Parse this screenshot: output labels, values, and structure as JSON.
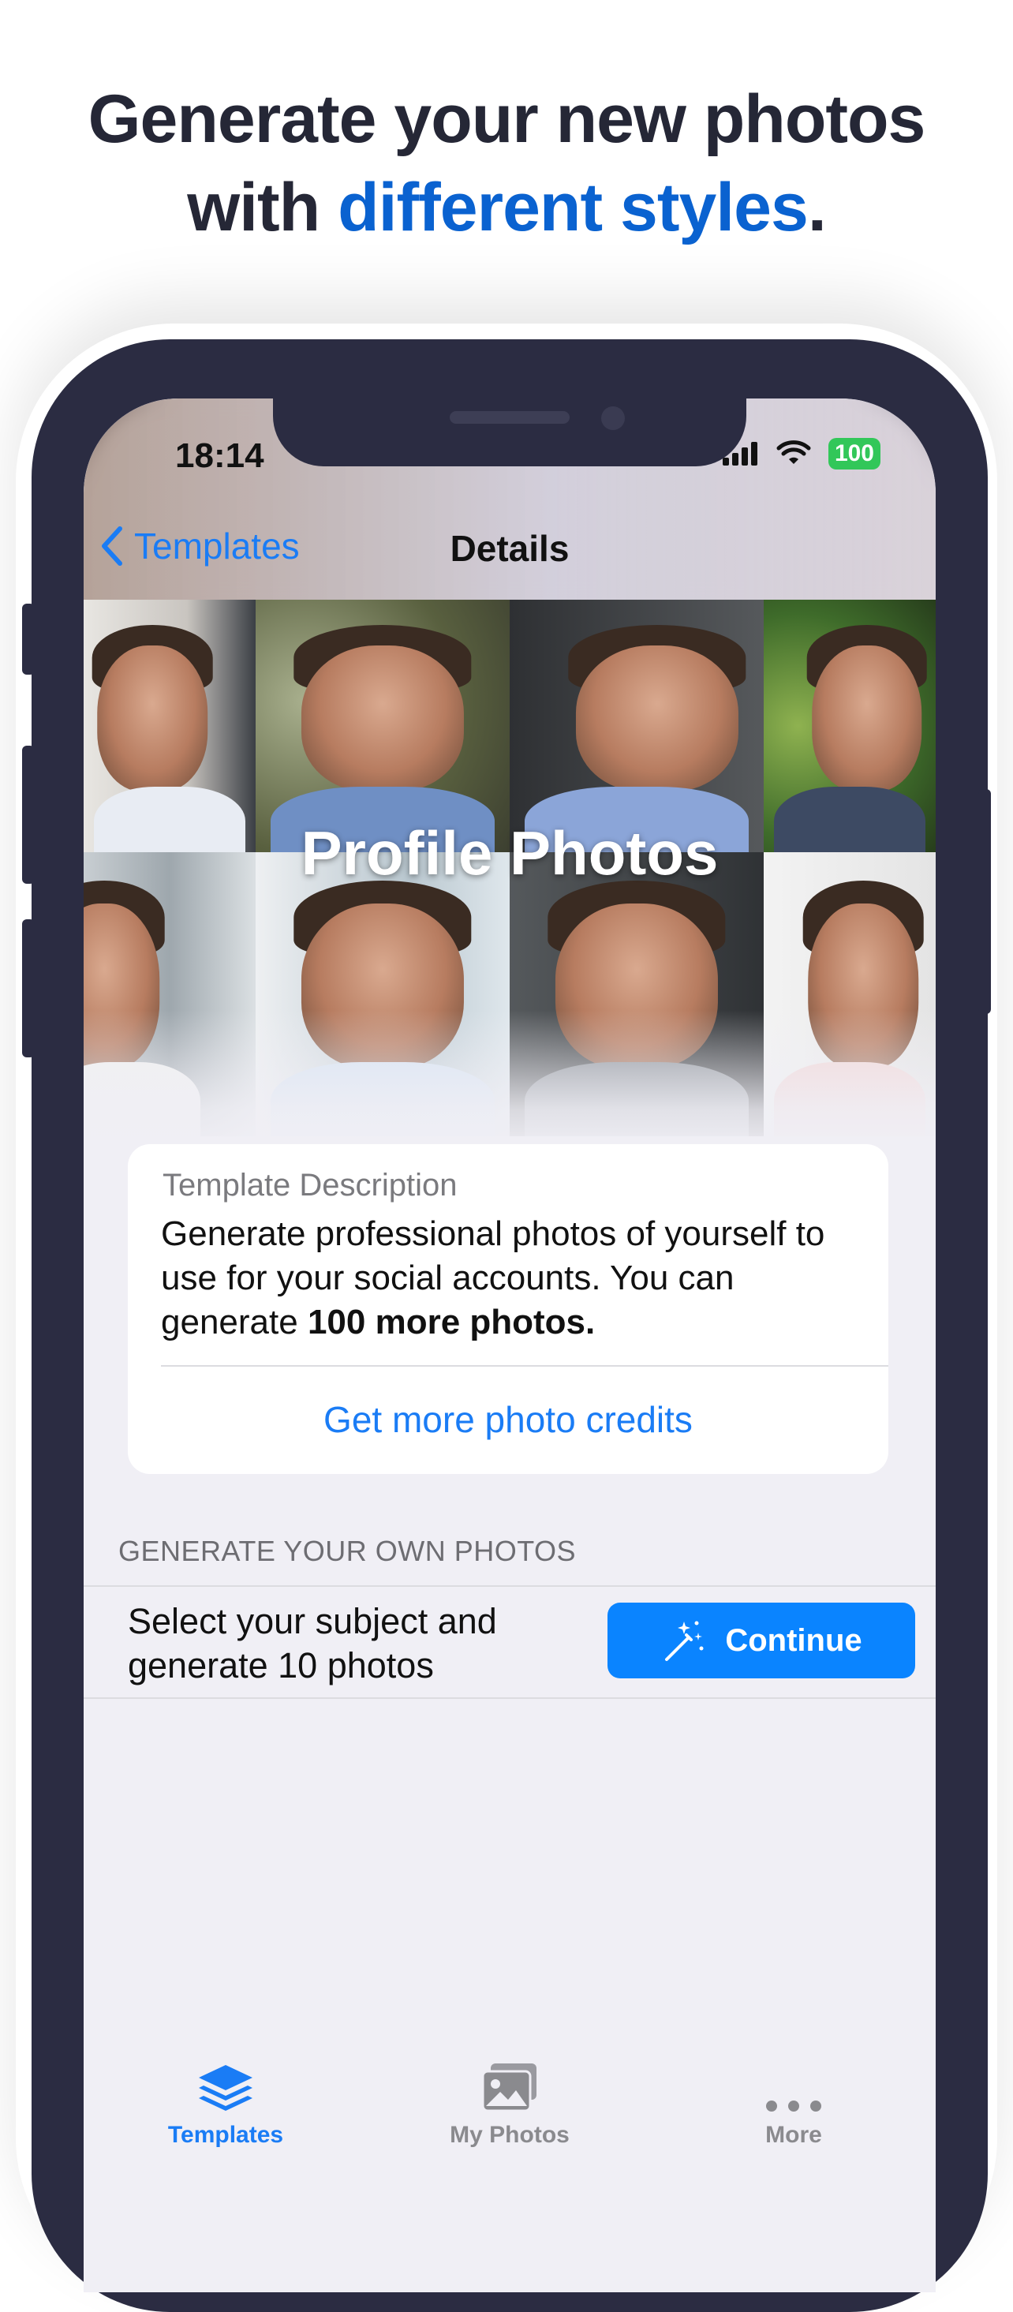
{
  "headline": {
    "line1": "Generate your new photos",
    "line2_prefix": "with ",
    "line2_accent": "different styles",
    "line2_suffix": "."
  },
  "status_bar": {
    "time": "18:14",
    "battery": "100"
  },
  "nav": {
    "back_label": "Templates",
    "title": "Details"
  },
  "hero": {
    "title": "Profile Photos"
  },
  "description_card": {
    "label": "Template Description",
    "text_prefix": "Generate professional photos of yourself to use for your social accounts. You can generate ",
    "text_bold": "100 more photos.",
    "link": "Get more photo credits"
  },
  "generate_section": {
    "header": "GENERATE YOUR OWN PHOTOS",
    "row_text": "Select your subject and generate 10 photos",
    "button_label": "Continue"
  },
  "tabbar": {
    "items": [
      {
        "label": "Templates",
        "icon": "stack-icon",
        "active": true
      },
      {
        "label": "My Photos",
        "icon": "photos-icon",
        "active": false
      },
      {
        "label": "More",
        "icon": "ellipsis-icon",
        "active": false
      }
    ]
  },
  "colors": {
    "accent": "#1a7cf5",
    "button": "#0a84ff",
    "phone": "#2b2c42",
    "battery": "#32c759"
  }
}
